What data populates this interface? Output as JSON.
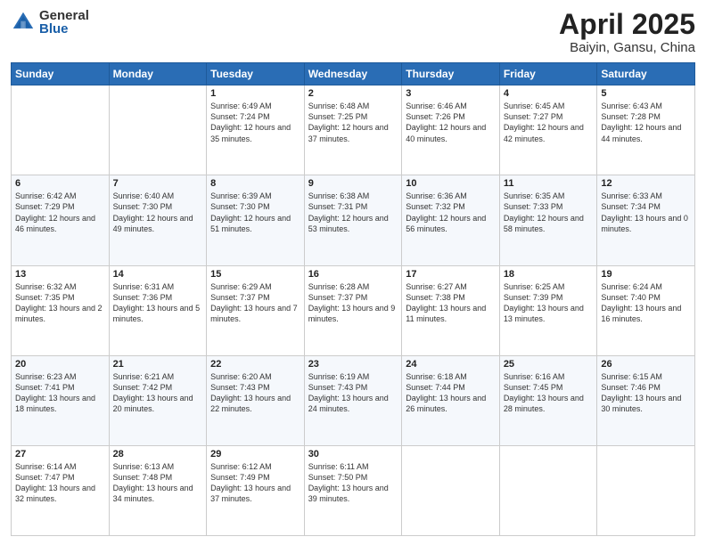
{
  "logo": {
    "general": "General",
    "blue": "Blue"
  },
  "title": {
    "month": "April 2025",
    "location": "Baiyin, Gansu, China"
  },
  "weekdays": [
    "Sunday",
    "Monday",
    "Tuesday",
    "Wednesday",
    "Thursday",
    "Friday",
    "Saturday"
  ],
  "weeks": [
    [
      {
        "day": "",
        "info": ""
      },
      {
        "day": "",
        "info": ""
      },
      {
        "day": "1",
        "info": "Sunrise: 6:49 AM\nSunset: 7:24 PM\nDaylight: 12 hours and 35 minutes."
      },
      {
        "day": "2",
        "info": "Sunrise: 6:48 AM\nSunset: 7:25 PM\nDaylight: 12 hours and 37 minutes."
      },
      {
        "day": "3",
        "info": "Sunrise: 6:46 AM\nSunset: 7:26 PM\nDaylight: 12 hours and 40 minutes."
      },
      {
        "day": "4",
        "info": "Sunrise: 6:45 AM\nSunset: 7:27 PM\nDaylight: 12 hours and 42 minutes."
      },
      {
        "day": "5",
        "info": "Sunrise: 6:43 AM\nSunset: 7:28 PM\nDaylight: 12 hours and 44 minutes."
      }
    ],
    [
      {
        "day": "6",
        "info": "Sunrise: 6:42 AM\nSunset: 7:29 PM\nDaylight: 12 hours and 46 minutes."
      },
      {
        "day": "7",
        "info": "Sunrise: 6:40 AM\nSunset: 7:30 PM\nDaylight: 12 hours and 49 minutes."
      },
      {
        "day": "8",
        "info": "Sunrise: 6:39 AM\nSunset: 7:30 PM\nDaylight: 12 hours and 51 minutes."
      },
      {
        "day": "9",
        "info": "Sunrise: 6:38 AM\nSunset: 7:31 PM\nDaylight: 12 hours and 53 minutes."
      },
      {
        "day": "10",
        "info": "Sunrise: 6:36 AM\nSunset: 7:32 PM\nDaylight: 12 hours and 56 minutes."
      },
      {
        "day": "11",
        "info": "Sunrise: 6:35 AM\nSunset: 7:33 PM\nDaylight: 12 hours and 58 minutes."
      },
      {
        "day": "12",
        "info": "Sunrise: 6:33 AM\nSunset: 7:34 PM\nDaylight: 13 hours and 0 minutes."
      }
    ],
    [
      {
        "day": "13",
        "info": "Sunrise: 6:32 AM\nSunset: 7:35 PM\nDaylight: 13 hours and 2 minutes."
      },
      {
        "day": "14",
        "info": "Sunrise: 6:31 AM\nSunset: 7:36 PM\nDaylight: 13 hours and 5 minutes."
      },
      {
        "day": "15",
        "info": "Sunrise: 6:29 AM\nSunset: 7:37 PM\nDaylight: 13 hours and 7 minutes."
      },
      {
        "day": "16",
        "info": "Sunrise: 6:28 AM\nSunset: 7:37 PM\nDaylight: 13 hours and 9 minutes."
      },
      {
        "day": "17",
        "info": "Sunrise: 6:27 AM\nSunset: 7:38 PM\nDaylight: 13 hours and 11 minutes."
      },
      {
        "day": "18",
        "info": "Sunrise: 6:25 AM\nSunset: 7:39 PM\nDaylight: 13 hours and 13 minutes."
      },
      {
        "day": "19",
        "info": "Sunrise: 6:24 AM\nSunset: 7:40 PM\nDaylight: 13 hours and 16 minutes."
      }
    ],
    [
      {
        "day": "20",
        "info": "Sunrise: 6:23 AM\nSunset: 7:41 PM\nDaylight: 13 hours and 18 minutes."
      },
      {
        "day": "21",
        "info": "Sunrise: 6:21 AM\nSunset: 7:42 PM\nDaylight: 13 hours and 20 minutes."
      },
      {
        "day": "22",
        "info": "Sunrise: 6:20 AM\nSunset: 7:43 PM\nDaylight: 13 hours and 22 minutes."
      },
      {
        "day": "23",
        "info": "Sunrise: 6:19 AM\nSunset: 7:43 PM\nDaylight: 13 hours and 24 minutes."
      },
      {
        "day": "24",
        "info": "Sunrise: 6:18 AM\nSunset: 7:44 PM\nDaylight: 13 hours and 26 minutes."
      },
      {
        "day": "25",
        "info": "Sunrise: 6:16 AM\nSunset: 7:45 PM\nDaylight: 13 hours and 28 minutes."
      },
      {
        "day": "26",
        "info": "Sunrise: 6:15 AM\nSunset: 7:46 PM\nDaylight: 13 hours and 30 minutes."
      }
    ],
    [
      {
        "day": "27",
        "info": "Sunrise: 6:14 AM\nSunset: 7:47 PM\nDaylight: 13 hours and 32 minutes."
      },
      {
        "day": "28",
        "info": "Sunrise: 6:13 AM\nSunset: 7:48 PM\nDaylight: 13 hours and 34 minutes."
      },
      {
        "day": "29",
        "info": "Sunrise: 6:12 AM\nSunset: 7:49 PM\nDaylight: 13 hours and 37 minutes."
      },
      {
        "day": "30",
        "info": "Sunrise: 6:11 AM\nSunset: 7:50 PM\nDaylight: 13 hours and 39 minutes."
      },
      {
        "day": "",
        "info": ""
      },
      {
        "day": "",
        "info": ""
      },
      {
        "day": "",
        "info": ""
      }
    ]
  ]
}
